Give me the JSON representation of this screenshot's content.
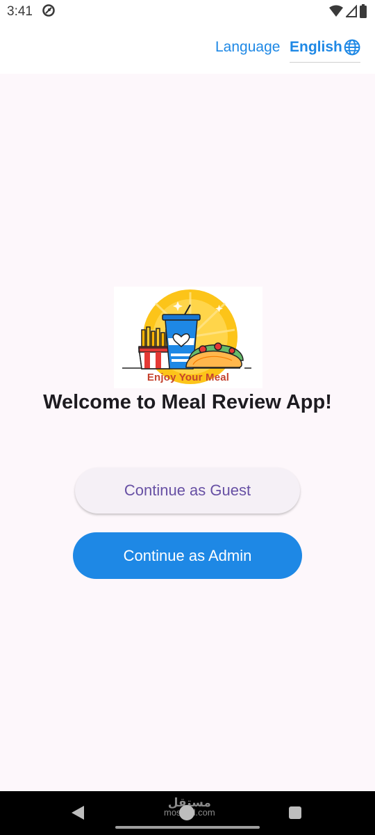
{
  "status_bar": {
    "time": "3:41",
    "icons": [
      "app-notification-icon",
      "wifi-icon",
      "signal-icon",
      "battery-icon"
    ]
  },
  "app_bar": {
    "language_label": "Language",
    "language_value": "English",
    "language_icon": "globe-icon"
  },
  "logo": {
    "caption": "Enjoy Your Meal"
  },
  "welcome_title": "Welcome to Meal Review App!",
  "buttons": {
    "guest": "Continue as Guest",
    "admin": "Continue as Admin"
  },
  "nav_bar": {
    "watermark_arabic": "مستقل",
    "watermark_latin": "mostaql.com"
  },
  "colors": {
    "accent": "#1e88e5",
    "guest_text": "#6750a4",
    "background": "#fdf7fb"
  }
}
